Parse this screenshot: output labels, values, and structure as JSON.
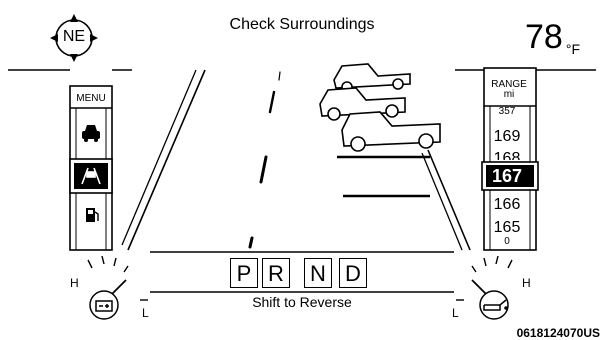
{
  "compass": {
    "heading": "NE"
  },
  "header": {
    "message": "Check Surroundings"
  },
  "temperature": {
    "value": "78",
    "unit": "°F"
  },
  "left_menu": {
    "label": "MENU",
    "items": [
      {
        "name": "vehicle",
        "icon": "car-icon",
        "selected": false
      },
      {
        "name": "lane",
        "icon": "lane-view-icon",
        "selected": true
      },
      {
        "name": "fuel",
        "icon": "fuel-pump-icon",
        "selected": false
      }
    ]
  },
  "range": {
    "label_line1": "RANGE",
    "label_line2": "mi",
    "values": [
      "357",
      "169",
      "168",
      "167",
      "166",
      "165",
      "0"
    ],
    "selected": "167"
  },
  "gears": [
    "P",
    "R",
    "N",
    "D"
  ],
  "subtitle": "Shift to Reverse",
  "left_gauge": {
    "high": "H",
    "low": "L",
    "icon": "battery-icon"
  },
  "right_gauge": {
    "high": "H",
    "low": "L",
    "icon": "oil-can-icon"
  },
  "figure_id": "0618124070US",
  "colors": {
    "foreground": "#000000",
    "background": "#ffffff"
  }
}
